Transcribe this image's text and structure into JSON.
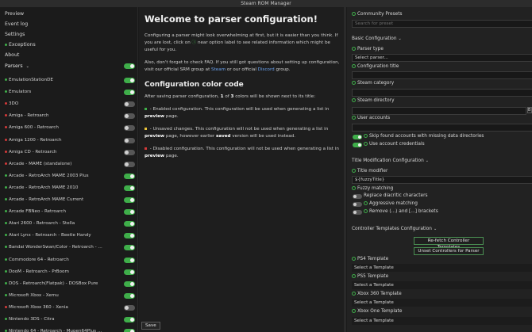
{
  "window": {
    "title": "Steam ROM Manager"
  },
  "nav": [
    {
      "label": "Preview",
      "dot": ""
    },
    {
      "label": "Event log",
      "dot": ""
    },
    {
      "label": "Settings",
      "dot": ""
    },
    {
      "label": "Exceptions",
      "dot": "#3fae4a"
    },
    {
      "label": "About",
      "dot": ""
    }
  ],
  "parsers_header": {
    "label": "Parsers",
    "chevron": "⌄",
    "enabled": true
  },
  "parsers": [
    {
      "label": "EmulationStationDE",
      "dot": "#3fae4a",
      "enabled": true
    },
    {
      "label": "Emulators",
      "dot": "#3fae4a",
      "enabled": true
    },
    {
      "label": "3DO",
      "dot": "#d43a3a",
      "enabled": false
    },
    {
      "label": "Amiga - Retroarch",
      "dot": "#d43a3a",
      "enabled": false
    },
    {
      "label": "Amiga 600 - Retroarch",
      "dot": "#d43a3a",
      "enabled": false
    },
    {
      "label": "Amiga 1200 - Retroarch",
      "dot": "#d43a3a",
      "enabled": false
    },
    {
      "label": "Amiga CD - Retroarch",
      "dot": "#d43a3a",
      "enabled": false
    },
    {
      "label": "Arcade - MAME (standalone)",
      "dot": "#d43a3a",
      "enabled": false
    },
    {
      "label": "Arcade - RetroArch MAME 2003 Plus",
      "dot": "#3fae4a",
      "enabled": true
    },
    {
      "label": "Arcade - RetroArch MAME 2010",
      "dot": "#3fae4a",
      "enabled": true
    },
    {
      "label": "Arcade - RetroArch MAME Current",
      "dot": "#3fae4a",
      "enabled": true
    },
    {
      "label": "Arcade FBNeo - Retroarch",
      "dot": "#3fae4a",
      "enabled": true
    },
    {
      "label": "Atari 2600 - Retroarch - Stella",
      "dot": "#3fae4a",
      "enabled": true
    },
    {
      "label": "Atari Lynx - Retroarch - Beetle Handy",
      "dot": "#3fae4a",
      "enabled": true
    },
    {
      "label": "Bandai WonderSwan/Color - Retroarch - ...",
      "dot": "#3fae4a",
      "enabled": true
    },
    {
      "label": "Commodore 64 - Retroarch",
      "dot": "#3fae4a",
      "enabled": true
    },
    {
      "label": "DooM - Retroarch - PrBoom",
      "dot": "#3fae4a",
      "enabled": true
    },
    {
      "label": "DOS - Retroarch(Flatpak) - DOSBox Pure",
      "dot": "#3fae4a",
      "enabled": true
    },
    {
      "label": "Microsoft Xbox - Xemu",
      "dot": "#3fae4a",
      "enabled": true
    },
    {
      "label": "Microsoft Xbox 360 - Xenia",
      "dot": "#d43a3a",
      "enabled": false
    },
    {
      "label": "Nintendo 3DS - Citra",
      "dot": "#3fae4a",
      "enabled": true
    },
    {
      "label": "Nintendo 64 - Retroarch - Mupen64Plus ...",
      "dot": "#3fae4a",
      "enabled": true
    }
  ],
  "center": {
    "title": "Welcome to parser configuration!",
    "intro_a": "Configuring a parser might look overwhelming at first, but it is easier than you think. If you are lost, click on",
    "intro_b": "near option label to see related information which might be useful for you.",
    "faq_a": "Also, don't forget to check FAQ. If you still got questions about setting up configuration, visit our official SRM group at",
    "faq_link1": "Steam",
    "faq_mid": "or our official",
    "faq_link2": "Discord",
    "faq_end": "group.",
    "color_heading": "Configuration color code",
    "after_a": "After saving parser configuration,",
    "after_n1": "1",
    "after_of": "of",
    "after_n2": "3",
    "after_b": "colors will be shown next to its title:",
    "enabled_a": "- Enabled configuration. This configuration will be used when generating a list in",
    "enabled_kw": "preview",
    "enabled_b": "page.",
    "unsaved_a": "- Unsaved changes. This configuration will not be used when generating a list in",
    "unsaved_kw": "preview",
    "unsaved_b": "page, however earlier",
    "unsaved_kw2": "saved",
    "unsaved_c": "version will be used instead.",
    "disabled_a": "- Disabled configuration. This configuration will not be used when generating a list in",
    "disabled_kw": "preview",
    "disabled_b": "page.",
    "colors": {
      "enabled": "#3fae4a",
      "unsaved": "#e8c23a",
      "disabled": "#d43a3a"
    }
  },
  "save_label": "Save",
  "right": {
    "community_presets": "Community Presets",
    "search_placeholder": "Search for preset",
    "basic_config": "Basic Configuration",
    "parser_type": "Parser type",
    "parser_type_value": "Select parser...",
    "config_title": "Configuration title",
    "steam_category": "Steam category",
    "steam_directory": "Steam directory",
    "browse_label": "B",
    "user_accounts": "User accounts",
    "skip_accounts": "Skip found accounts with missing data directories",
    "use_credentials": "Use account credentials",
    "title_mod_config": "Title Modification Configuration",
    "title_modifier": "Title modifier",
    "title_modifier_value": "${fuzzyTitle}",
    "fuzzy_matching": "Fuzzy matching",
    "replace_diacritic": "Replace diacritic characters",
    "aggressive_matching": "Aggressive matching",
    "remove_brackets": "Remove (...) and [...] brackets",
    "controller_templates_config": "Controller Templates Configuration",
    "refetch_btn": "Re-fetch Controller Templates",
    "unset_btn": "Unset Controllers for Parser",
    "ps4_template": "PS4 Template",
    "ps5_template": "PS5 Template",
    "xbox360_template": "Xbox 360 Template",
    "xboxone_template": "Xbox One Template",
    "select_template": "Select a Template"
  }
}
